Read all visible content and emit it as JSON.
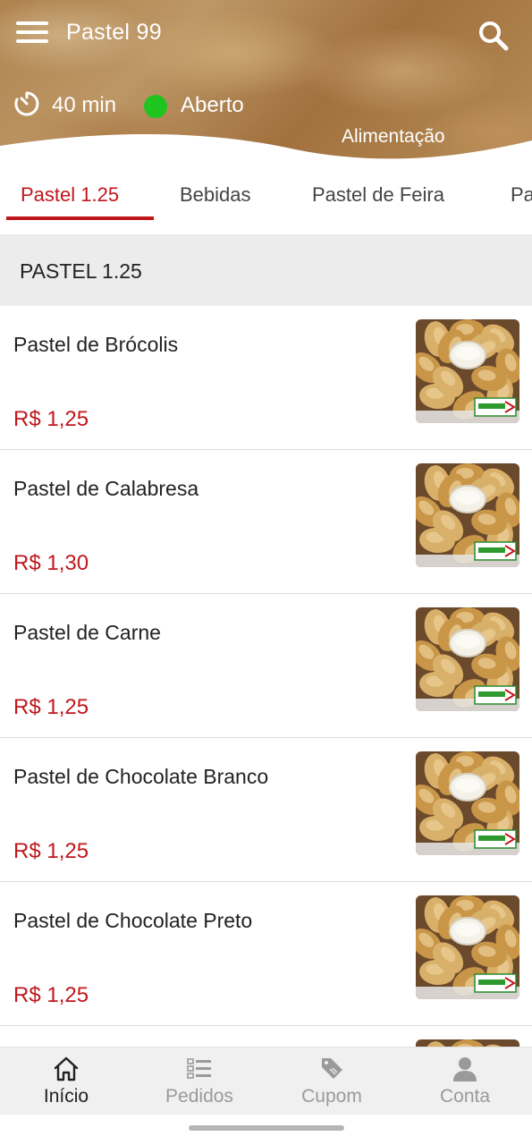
{
  "header": {
    "store_name": "Pastel 99",
    "delivery_time": "40 min",
    "status": "Aberto",
    "status_color": "#1fc41f",
    "category": "Alimentação",
    "menu_icon": "hamburger-menu-icon",
    "search_icon": "search-icon",
    "timer_icon": "timer-icon"
  },
  "tabs": [
    {
      "label": "Pastel 1.25",
      "active": true
    },
    {
      "label": "Bebidas",
      "active": false
    },
    {
      "label": "Pastel de Feira",
      "active": false
    },
    {
      "label": "Pa",
      "active": false
    }
  ],
  "section": {
    "title": "PASTEL 1.25"
  },
  "products": [
    {
      "name": "Pastel de Brócolis",
      "price": "R$ 1,25"
    },
    {
      "name": "Pastel de Calabresa",
      "price": "R$ 1,30"
    },
    {
      "name": "Pastel de Carne",
      "price": "R$ 1,25"
    },
    {
      "name": "Pastel de Chocolate Branco",
      "price": "R$ 1,25"
    },
    {
      "name": "Pastel de Chocolate Preto",
      "price": "R$ 1,25"
    },
    {
      "name": "",
      "price": ""
    }
  ],
  "bottom_nav": [
    {
      "label": "Início",
      "icon": "home-icon",
      "active": true
    },
    {
      "label": "Pedidos",
      "icon": "orders-list-icon",
      "active": false
    },
    {
      "label": "Cupom",
      "icon": "coupon-tag-icon",
      "active": false
    },
    {
      "label": "Conta",
      "icon": "user-icon",
      "active": false
    }
  ],
  "colors": {
    "accent": "#c0171b",
    "status_open": "#1fc41f"
  }
}
